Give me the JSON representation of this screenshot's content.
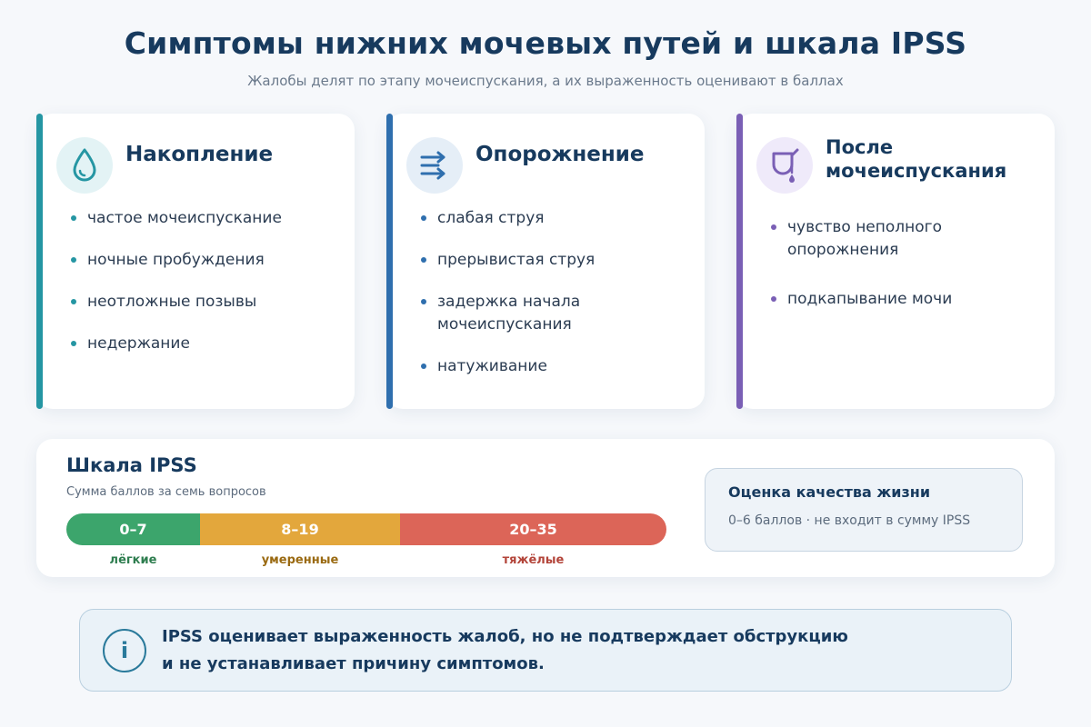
{
  "header": {
    "title": "Симптомы нижних мочевых путей и шкала IPSS",
    "subtitle": "Жалобы делят по этапу мочеиспускания, а их выраженность оценивают в баллах"
  },
  "cards": [
    {
      "title": "Накопление",
      "icon": "droplet-icon",
      "accent": "#2596a3",
      "icon_bg": "#e3f3f5",
      "items": [
        "частое мочеиспускание",
        "ночные пробуждения",
        "неотложные позывы",
        "недержание"
      ]
    },
    {
      "title": "Опорожнение",
      "icon": "flow-arrows-icon",
      "accent": "#2f6fae",
      "icon_bg": "#e5eef7",
      "items": [
        "слабая струя",
        "прерывистая струя",
        "задержка начала мочеиспускания",
        "натуживание"
      ]
    },
    {
      "title": "После мочеиспускания",
      "title_line1": "После",
      "title_line2": "мочеиспускания",
      "icon": "dripping-container-icon",
      "accent": "#7a5fb5",
      "icon_bg": "#efeafa",
      "items": [
        "чувство неполного опорожнения",
        "подкапывание мочи"
      ]
    }
  ],
  "ipss": {
    "title": "Шкала IPSS",
    "subtitle": "Сумма баллов за семь вопросов",
    "segments": [
      {
        "range": "0–7",
        "label": "лёгкие",
        "color": "#3ca56c",
        "label_color": "#2e7d4f"
      },
      {
        "range": "8–19",
        "label": "умеренные",
        "color": "#e3a73c",
        "label_color": "#9a6a12"
      },
      {
        "range": "20–35",
        "label": "тяжёлые",
        "color": "#dc6558",
        "label_color": "#b3453a"
      }
    ],
    "qol": {
      "title": "Оценка качества жизни",
      "text": "0–6 баллов · не входит в сумму IPSS"
    }
  },
  "note": {
    "line1": "IPSS оценивает выраженность жалоб, но не подтверждает обструкцию",
    "line2": "и не устанавливает причину симптомов.",
    "icon": "info-icon"
  }
}
